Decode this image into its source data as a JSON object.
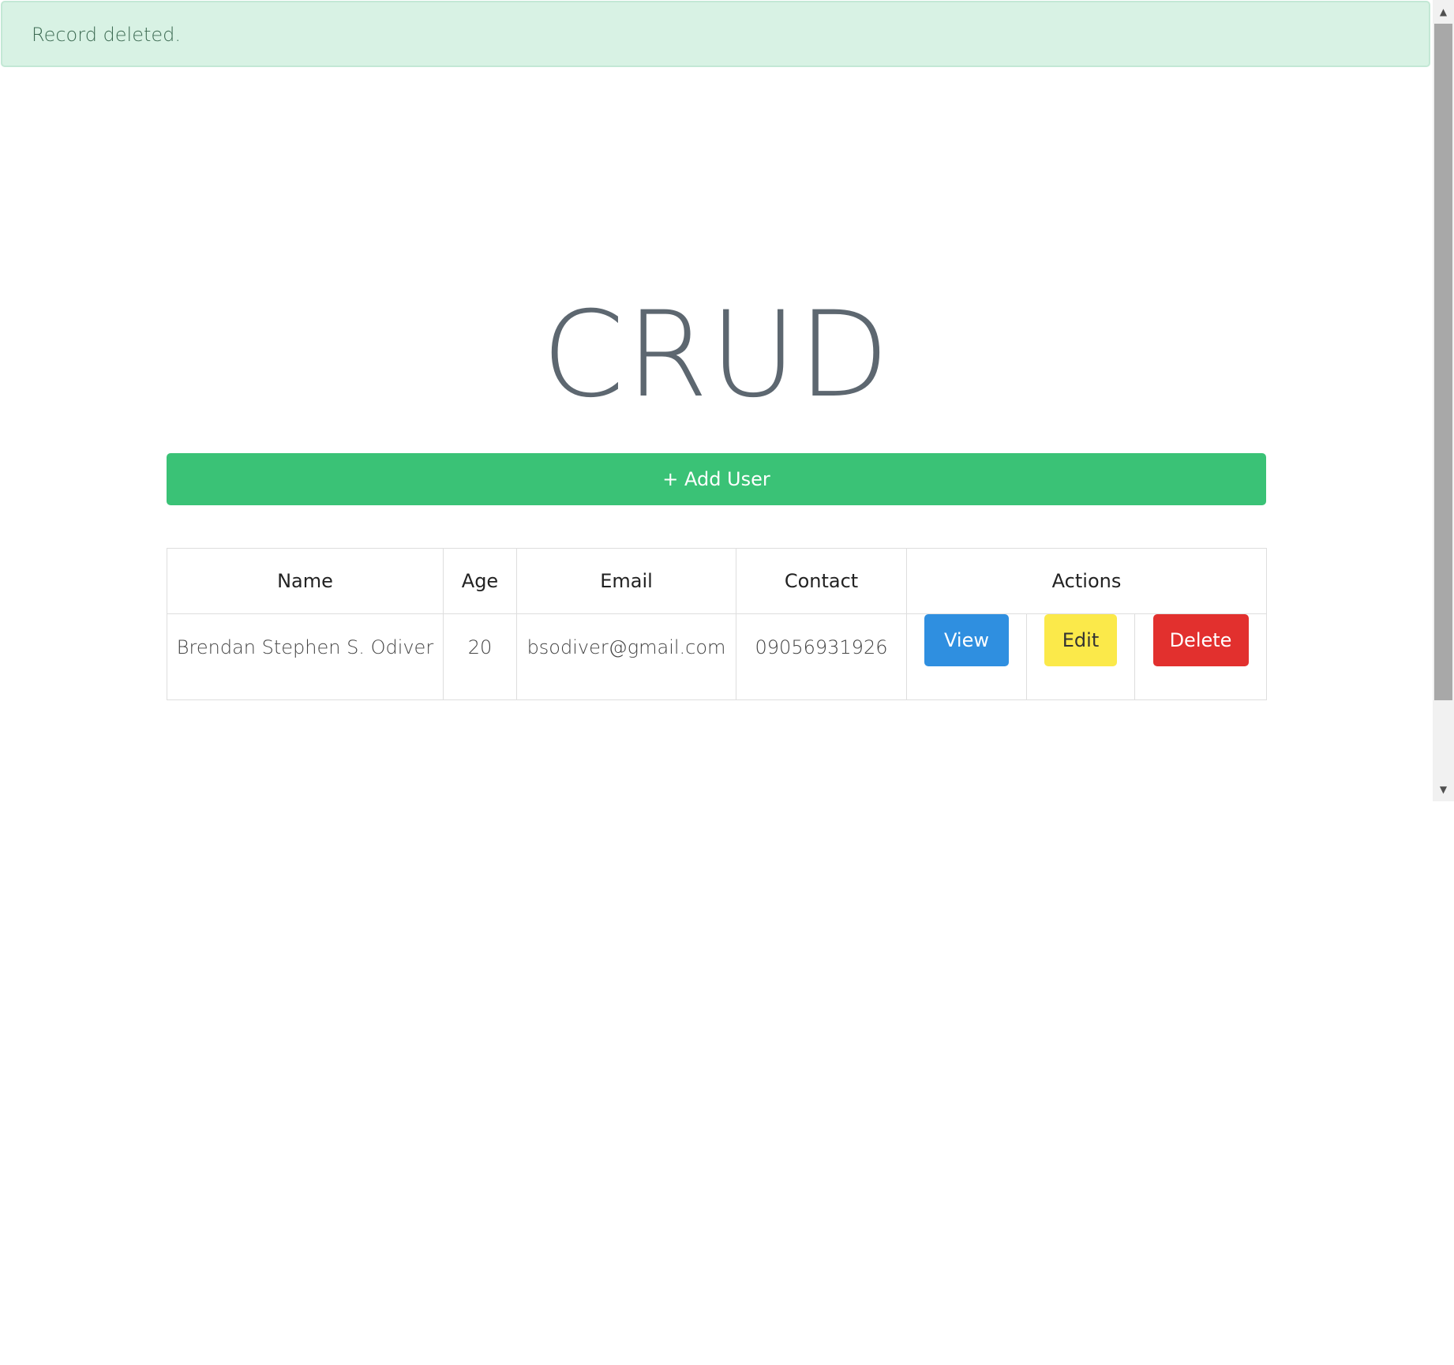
{
  "alert": {
    "message": "Record deleted."
  },
  "page": {
    "title": "CRUD"
  },
  "toolbar": {
    "add_user_label": "+ Add User"
  },
  "table": {
    "headers": [
      "Name",
      "Age",
      "Email",
      "Contact",
      "Actions"
    ],
    "rows": [
      {
        "name": "Brendan Stephen S. Odiver",
        "age": "20",
        "email": "bsodiver@gmail.com",
        "contact": "09056931926",
        "actions": {
          "view": "View",
          "edit": "Edit",
          "delete": "Delete"
        }
      }
    ]
  },
  "colors": {
    "alert_bg": "#d8f2e4",
    "add_button": "#3ac276",
    "view_button": "#2f8fe0",
    "edit_button": "#fbe94a",
    "delete_button": "#e2302e"
  },
  "icons": {
    "scroll_up": "scroll-up-arrow-icon",
    "scroll_down": "scroll-down-arrow-icon"
  }
}
